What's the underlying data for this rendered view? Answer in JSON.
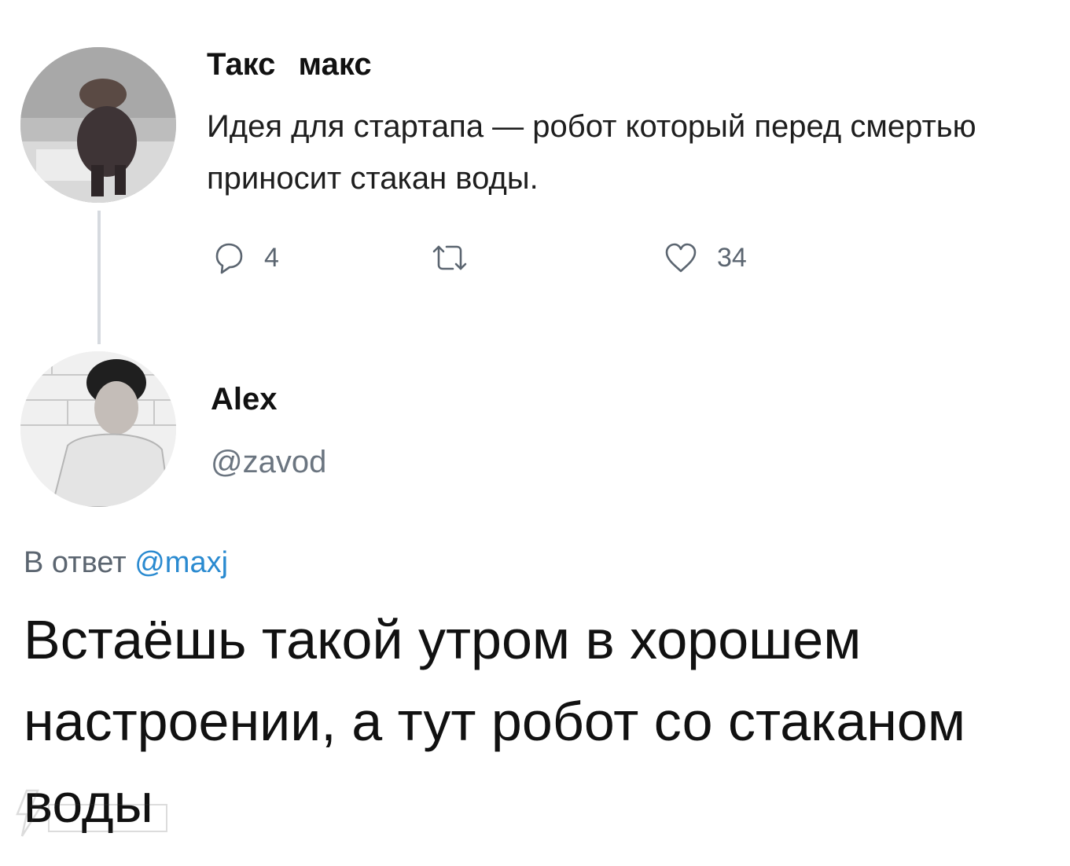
{
  "thread": {
    "parent": {
      "author_name": "Такс макс",
      "text": "Идея для стартапа — робот который перед смертью приносит стакан воды.",
      "actions": {
        "reply_icon": "reply-icon",
        "reply_count": "4",
        "retweet_icon": "retweet-icon",
        "like_icon": "heart-icon",
        "like_count": "34"
      }
    },
    "reply": {
      "author_name": "Alex",
      "author_handle": "@zavod",
      "reply_to_prefix": "В ответ",
      "reply_to_mention": "@maxj",
      "text": "Встаёшь такой утром в хорошем настроении, а тут робот со стаканом воды"
    }
  },
  "colors": {
    "text": "#111111",
    "secondary": "#5b6570",
    "mention": "#2a8ad0",
    "thread_line": "#d6dadf"
  }
}
